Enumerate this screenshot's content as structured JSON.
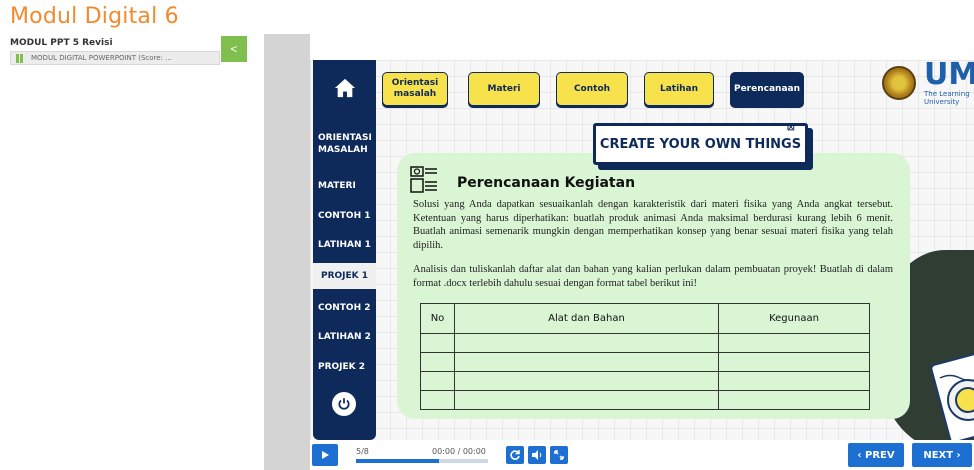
{
  "app": {
    "title": "Modul Digital 6"
  },
  "sidebar": {
    "module_title": "MODUL PPT 5 Revisi",
    "item": "MODUL DIGITAL POWERPOINT (Score: ...",
    "collapse_symbol": "<",
    "accent": "#7fbf4d"
  },
  "slide": {
    "top_buttons": [
      {
        "label": "Orientasi masalah"
      },
      {
        "label": "Materi"
      },
      {
        "label": "Contoh"
      },
      {
        "label": "Latihan"
      },
      {
        "label": "Perencanaan"
      }
    ],
    "side_nav": [
      {
        "label": "ORIENTASI MASALAH"
      },
      {
        "label": "MATERI"
      },
      {
        "label": "CONTOH 1"
      },
      {
        "label": "LATIHAN 1"
      },
      {
        "label": "PROJEK 1"
      },
      {
        "label": "CONTOH 2"
      },
      {
        "label": "LATIHAN 2"
      },
      {
        "label": "PROJEK 2"
      }
    ],
    "logo": {
      "um": "UM",
      "tagline": "The Learning University"
    },
    "banner": "CREATE YOUR OWN THINGS",
    "card": {
      "title": "Perencanaan Kegiatan",
      "paragraph1": "Solusi yang Anda dapatkan sesuaikanlah dengan karakteristik dari materi fisika yang Anda angkat  tersebut. Ketentuan yang harus diperhatikan: buatlah produk animasi Anda maksimal berdurasi kurang lebih 6 menit. Buatlah animasi semenarik mungkin dengan memperhatikan konsep yang benar sesuai materi fisika yang telah dipilih.",
      "paragraph2": "Analisis dan tuliskanlah daftar alat  dan bahan  yang kalian perlukan dalam pembuatan proyek! Buatlah di dalam format .docx terlebih dahulu sesuai dengan format tabel berikut ini!",
      "table_headers": [
        "No",
        "Alat dan Bahan",
        "Kegunaan"
      ],
      "table_rows": 4
    },
    "colors": {
      "navy": "#0e2a5a",
      "yellow": "#f7e24b",
      "card": "#d9f5d3"
    }
  },
  "player": {
    "slide_count": "5/8",
    "time": "00:00 / 00:00",
    "progress": 0.625,
    "prev": "PREV",
    "next": "NEXT",
    "accent": "#1d6fd1"
  }
}
